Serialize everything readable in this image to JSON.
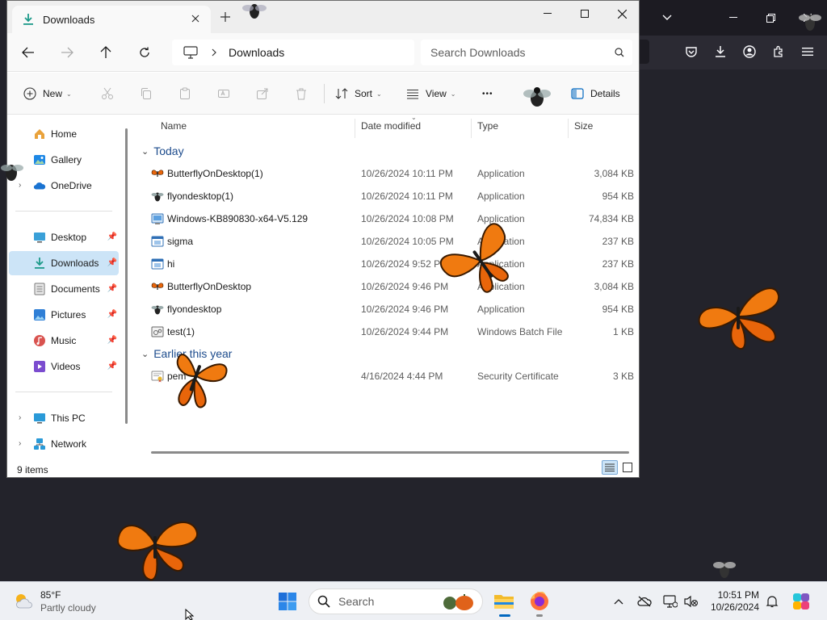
{
  "explorer": {
    "tab_title": "Downloads",
    "path_segment": "Downloads",
    "search_placeholder": "Search Downloads",
    "commands": {
      "new": "New",
      "sort": "Sort",
      "view": "View",
      "more": "•••",
      "details": "Details"
    },
    "nav": {
      "home": "Home",
      "gallery": "Gallery",
      "onedrive": "OneDrive",
      "desktop": "Desktop",
      "downloads": "Downloads",
      "documents": "Documents",
      "pictures": "Pictures",
      "music": "Music",
      "videos": "Videos",
      "thispc": "This PC",
      "network": "Network"
    },
    "columns": {
      "name": "Name",
      "date": "Date modified",
      "type": "Type",
      "size": "Size"
    },
    "groups": {
      "today": "Today",
      "earlier": "Earlier this year"
    },
    "files_today": [
      {
        "name": "ButterflyOnDesktop(1)",
        "date": "10/26/2024 10:11 PM",
        "type": "Application",
        "size": "3,084 KB",
        "icon": "butterfly-icon"
      },
      {
        "name": "flyondesktop(1)",
        "date": "10/26/2024 10:11 PM",
        "type": "Application",
        "size": "954 KB",
        "icon": "fly-icon"
      },
      {
        "name": "Windows-KB890830-x64-V5.129",
        "date": "10/26/2024 10:08 PM",
        "type": "Application",
        "size": "74,834 KB",
        "icon": "installer-icon"
      },
      {
        "name": "sigma",
        "date": "10/26/2024 10:05 PM",
        "type": "Application",
        "size": "237 KB",
        "icon": "app-window-icon"
      },
      {
        "name": "hi",
        "date": "10/26/2024 9:52 PM",
        "type": "Application",
        "size": "237 KB",
        "icon": "app-window-icon"
      },
      {
        "name": "ButterflyOnDesktop",
        "date": "10/26/2024 9:46 PM",
        "type": "Application",
        "size": "3,084 KB",
        "icon": "butterfly-icon"
      },
      {
        "name": "flyondesktop",
        "date": "10/26/2024 9:46 PM",
        "type": "Application",
        "size": "954 KB",
        "icon": "fly-icon"
      },
      {
        "name": "test(1)",
        "date": "10/26/2024 9:44 PM",
        "type": "Windows Batch File",
        "size": "1 KB",
        "icon": "batch-file-icon"
      }
    ],
    "files_earlier": [
      {
        "name": "pem",
        "date": "4/16/2024 4:44 PM",
        "type": "Security Certificate",
        "size": "3 KB",
        "icon": "certificate-icon"
      }
    ],
    "status": "9 items"
  },
  "taskbar": {
    "temperature": "85°F",
    "condition": "Partly cloudy",
    "search_label": "Search",
    "time": "10:51 PM",
    "date": "10/26/2024"
  },
  "colors": {
    "accent": "#0067c0",
    "group_header": "#1c4b8c",
    "selection": "#cce4f7",
    "butterfly_orange": "#f07a10"
  }
}
